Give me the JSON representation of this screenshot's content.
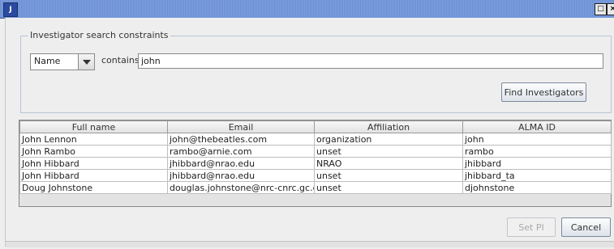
{
  "window": {
    "app_icon": "java-icon",
    "maximize_glyph": "□",
    "close_glyph": "×"
  },
  "search": {
    "legend": "Investigator search constraints",
    "field_selected": "Name",
    "operator_label": "contains",
    "query_value": "john",
    "find_button": "Find Investigators"
  },
  "results": {
    "columns": [
      "Full name",
      "Email",
      "Affiliation",
      "ALMA ID"
    ],
    "rows": [
      [
        "John Lennon",
        "john@thebeatles.com",
        "organization",
        "john"
      ],
      [
        "John Rambo",
        "rambo@arnie.com",
        "unset",
        "rambo"
      ],
      [
        "John Hibbard",
        "jhibbard@nrao.edu",
        "NRAO",
        "jhibbard"
      ],
      [
        "John Hibbard",
        "jhibbard@nrao.edu",
        "unset",
        "jhibbard_ta"
      ],
      [
        "Doug Johnstone",
        "douglas.johnstone@nrc-cnrc.gc.ca",
        "unset",
        "djohnstone"
      ]
    ]
  },
  "footer": {
    "set_pi_button": "Set PI",
    "cancel_button": "Cancel"
  }
}
